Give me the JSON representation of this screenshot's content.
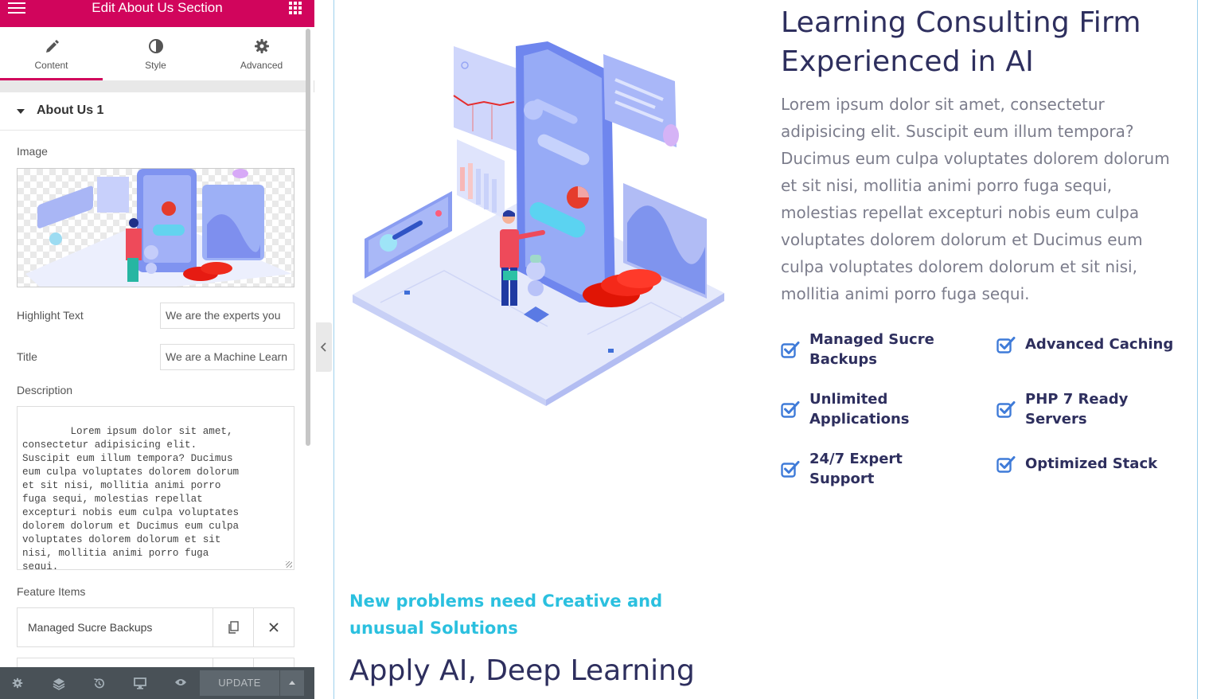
{
  "panel": {
    "title": "Edit About Us Section",
    "tabs": [
      {
        "label": "Content",
        "icon": "pencil-icon"
      },
      {
        "label": "Style",
        "icon": "half-circle-icon"
      },
      {
        "label": "Advanced",
        "icon": "gear-icon"
      }
    ],
    "section_title": "About Us 1",
    "image_label": "Image",
    "highlight_label": "Highlight Text",
    "highlight_value": "We are the experts you",
    "title_label": "Title",
    "title_value": "We are a Machine Learn",
    "description_label": "Description",
    "description_value": "Lorem ipsum dolor sit amet,\nconsectetur adipisicing elit.\nSuscipit eum illum tempora? Ducimus\neum culpa voluptates dolorem dolorum\net sit nisi, mollitia animi porro\nfuga sequi, molestias repellat\nexcepturi nobis eum culpa voluptates\ndolorem dolorum et Ducimus eum culpa\nvoluptates dolorem dolorum et sit\nnisi, mollitia animi porro fuga\nsequi.",
    "feature_items_label": "Feature Items",
    "feature_items": [
      "Managed Sucre Backups"
    ],
    "footer": {
      "update_label": "UPDATE"
    },
    "accent_color": "#d1055c"
  },
  "preview": {
    "heading": "Learning Consulting Firm Experienced in AI",
    "description": "Lorem ipsum dolor sit amet, consectetur adipisicing elit. Suscipit eum illum tempora? Ducimus eum culpa voluptates dolorem dolorum et sit nisi, mollitia animi porro fuga sequi, molestias repellat excepturi nobis eum culpa voluptates dolorem dolorum et Ducimus eum culpa voluptates dolorem dolorum et sit nisi, mollitia animi porro fuga sequi.",
    "features": [
      {
        "label": "Managed Sucre Backups"
      },
      {
        "label": "Advanced Caching"
      },
      {
        "label": "Unlimited Applications"
      },
      {
        "label": "PHP 7 Ready Servers"
      },
      {
        "label": "24/7 Expert Support"
      },
      {
        "label": "Optimized Stack"
      }
    ],
    "highlight": "New problems need Creative and unusual Solutions",
    "section2_title": "Apply AI, Deep Learning",
    "heading_color": "#2e2f5e",
    "highlight_color": "#2bc0df",
    "check_color": "#3f7bd8"
  }
}
